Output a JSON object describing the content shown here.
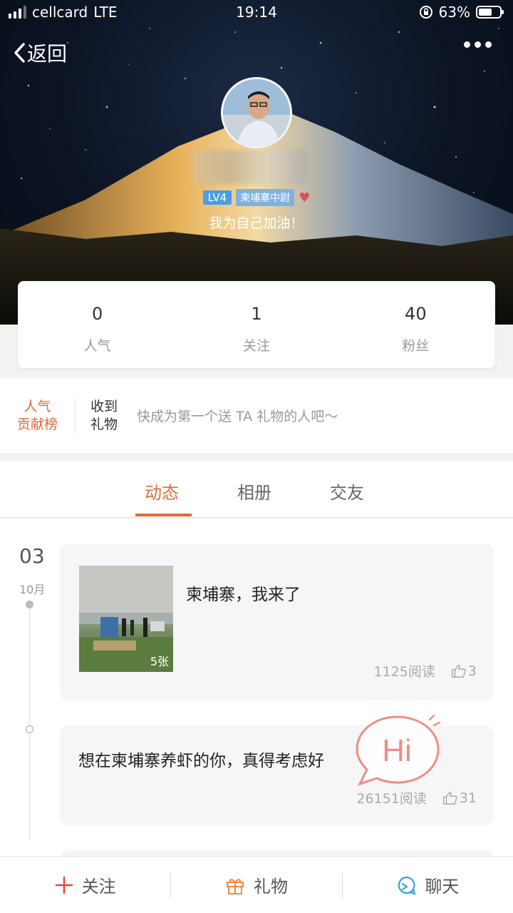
{
  "status": {
    "carrier": "cellcard",
    "network": "LTE",
    "time": "19:14",
    "battery": "63%"
  },
  "nav": {
    "back_label": "返回"
  },
  "profile": {
    "level": "LV4",
    "title_badge": "柬埔寨中尉",
    "signature": "我为自己加油！"
  },
  "stats": [
    {
      "value": "0",
      "label": "人气"
    },
    {
      "value": "1",
      "label": "关注"
    },
    {
      "value": "40",
      "label": "粉丝"
    }
  ],
  "gifts": {
    "rank_line1": "人气",
    "rank_line2": "贡献榜",
    "received_line1": "收到",
    "received_line2": "礼物",
    "hint": "快成为第一个送 TA 礼物的人吧～"
  },
  "tabs": [
    {
      "label": "动态"
    },
    {
      "label": "相册"
    },
    {
      "label": "交友"
    }
  ],
  "feed": {
    "date_day": "03",
    "date_month": "10月",
    "posts": [
      {
        "text": "柬埔寨，我来了",
        "photo_count": "5张",
        "reads": "1125阅读",
        "likes": "3"
      },
      {
        "text": "想在柬埔寨养虾的你，真得考虑好",
        "reads": "26151阅读",
        "likes": "31"
      }
    ],
    "hi_label": "Hi"
  },
  "bottombar": {
    "follow": "关注",
    "gift": "礼物",
    "chat": "聊天"
  },
  "colors": {
    "accent": "#e06b3a",
    "level_badge": "#4a9ee8",
    "hi_bubble": "#ef8c84",
    "chat_icon": "#3aa0e0"
  }
}
